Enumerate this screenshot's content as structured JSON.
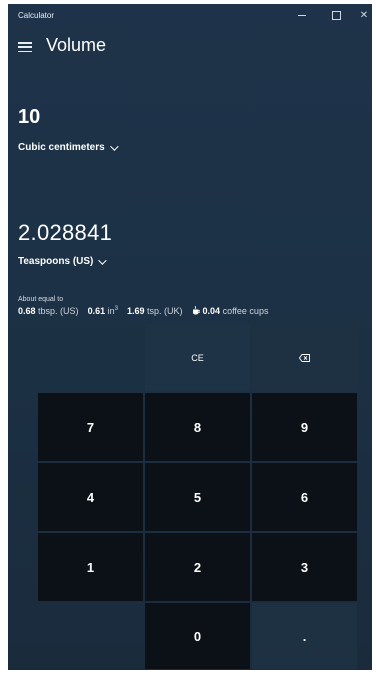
{
  "window": {
    "app_title": "Calculator",
    "minimize_glyph": "–",
    "close_glyph": "✕"
  },
  "nav": {
    "mode_title": "Volume"
  },
  "from": {
    "value": "10",
    "unit": "Cubic centimeters"
  },
  "to": {
    "value": "2.028841",
    "unit": "Teaspoons (US)"
  },
  "about": {
    "label": "About equal to",
    "items": [
      {
        "value": "0.68",
        "unit": "tbsp. (US)"
      },
      {
        "value": "0.61",
        "unit": "in",
        "sup": "3"
      },
      {
        "value": "1.69",
        "unit": "tsp. (UK)"
      },
      {
        "value": "0.04",
        "unit": "coffee cups",
        "icon": "coffee-cup-icon"
      }
    ]
  },
  "keypad": {
    "ce": "CE",
    "backspace_icon": "backspace-icon",
    "k7": "7",
    "k8": "8",
    "k9": "9",
    "k4": "4",
    "k5": "5",
    "k6": "6",
    "k1": "1",
    "k2": "2",
    "k3": "3",
    "k0": "0",
    "decimal": "."
  }
}
